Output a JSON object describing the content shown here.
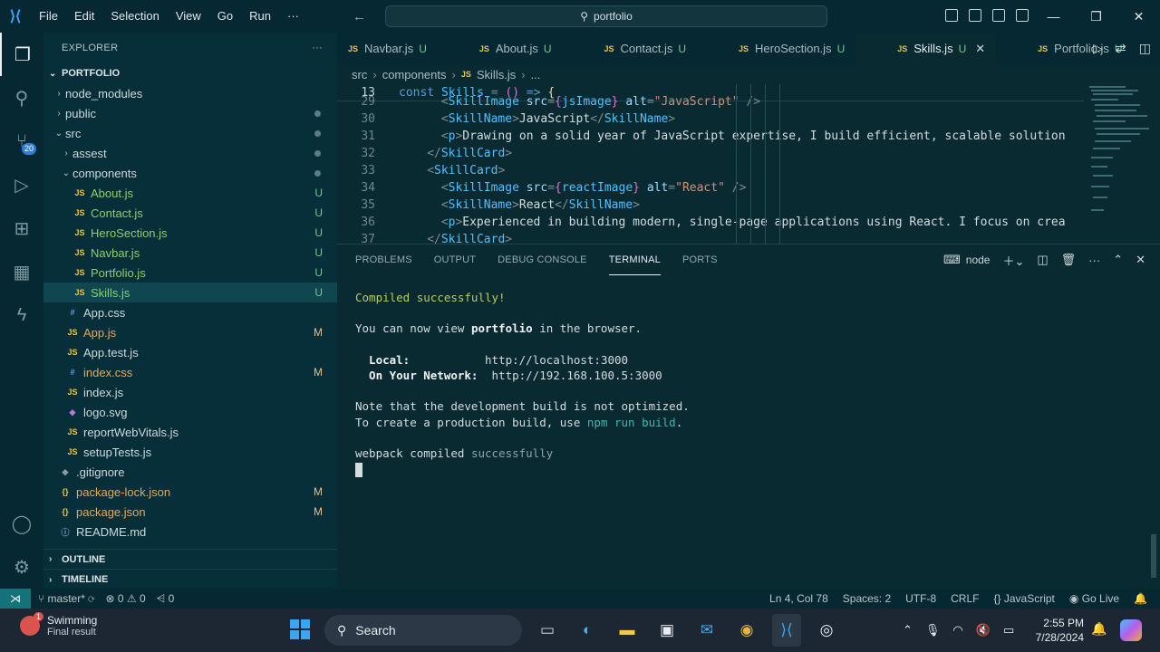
{
  "titlebar": {
    "menu": [
      "File",
      "Edit",
      "Selection",
      "View",
      "Go",
      "Run",
      "···"
    ],
    "search_text": "portfolio",
    "window_controls": [
      "—",
      "❐",
      "✕"
    ]
  },
  "activity": {
    "scm_badge": "20",
    "icons": [
      "explorer-icon",
      "search-icon",
      "source-control-icon",
      "run-debug-icon",
      "extensions-icon",
      "docker-icon",
      "remote-icon"
    ],
    "bottom_icons": [
      "account-icon",
      "settings-icon"
    ]
  },
  "explorer": {
    "title": "EXPLORER",
    "more": "···",
    "root": "PORTFOLIO",
    "items": [
      {
        "label": "node_modules",
        "type": "folder",
        "indent": 1,
        "chev": "›",
        "status": "",
        "dot": false
      },
      {
        "label": "public",
        "type": "folder",
        "indent": 1,
        "chev": "›",
        "status": "",
        "dot": true
      },
      {
        "label": "src",
        "type": "folder",
        "indent": 1,
        "chev": "⌄",
        "status": "",
        "dot": true
      },
      {
        "label": "assest",
        "type": "folder",
        "indent": 2,
        "chev": "›",
        "status": "",
        "dot": true
      },
      {
        "label": "components",
        "type": "folder",
        "indent": 2,
        "chev": "⌄",
        "status": "",
        "dot": true
      },
      {
        "label": "About.js",
        "type": "js",
        "indent": 3,
        "status": "U"
      },
      {
        "label": "Contact.js",
        "type": "js",
        "indent": 3,
        "status": "U"
      },
      {
        "label": "HeroSection.js",
        "type": "js",
        "indent": 3,
        "status": "U"
      },
      {
        "label": "Navbar.js",
        "type": "js",
        "indent": 3,
        "status": "U"
      },
      {
        "label": "Portfolio.js",
        "type": "js",
        "indent": 3,
        "status": "U"
      },
      {
        "label": "Skills.js",
        "type": "js",
        "indent": 3,
        "status": "U",
        "selected": true
      },
      {
        "label": "App.css",
        "type": "css",
        "indent": 2,
        "status": ""
      },
      {
        "label": "App.js",
        "type": "js",
        "indent": 2,
        "status": "M"
      },
      {
        "label": "App.test.js",
        "type": "js",
        "indent": 2,
        "status": ""
      },
      {
        "label": "index.css",
        "type": "css",
        "indent": 2,
        "status": "M"
      },
      {
        "label": "index.js",
        "type": "js",
        "indent": 2,
        "status": ""
      },
      {
        "label": "logo.svg",
        "type": "svg",
        "indent": 2,
        "status": ""
      },
      {
        "label": "reportWebVitals.js",
        "type": "js",
        "indent": 2,
        "status": ""
      },
      {
        "label": "setupTests.js",
        "type": "js",
        "indent": 2,
        "status": ""
      },
      {
        "label": ".gitignore",
        "type": "git",
        "indent": 1,
        "status": ""
      },
      {
        "label": "package-lock.json",
        "type": "json",
        "indent": 1,
        "status": "M"
      },
      {
        "label": "package.json",
        "type": "json",
        "indent": 1,
        "status": "M"
      },
      {
        "label": "README.md",
        "type": "md",
        "indent": 1,
        "status": ""
      }
    ],
    "outline": "OUTLINE",
    "timeline": "TIMELINE"
  },
  "tabs": [
    {
      "label": "Navbar.js",
      "status": "U",
      "active": false
    },
    {
      "label": "About.js",
      "status": "U",
      "active": false
    },
    {
      "label": "Contact.js",
      "status": "U",
      "active": false
    },
    {
      "label": "HeroSection.js",
      "status": "U",
      "active": false
    },
    {
      "label": "Skills.js",
      "status": "U",
      "active": true
    },
    {
      "label": "Portfolio.js",
      "status": "U",
      "active": false
    }
  ],
  "breadcrumb": [
    "src",
    "components",
    "Skills.js",
    "..."
  ],
  "code": {
    "sticky": {
      "ln": "13",
      "text": "const Skills = () => {"
    },
    "lines": [
      {
        "ln": "29",
        "text": "<SkillImage src={jsImage} alt=\"JavaScript\" />"
      },
      {
        "ln": "30",
        "text": "<SkillName>JavaScript</SkillName>"
      },
      {
        "ln": "31",
        "text": "<p>Drawing on a solid year of JavaScript expertise, I build efficient, scalable solution"
      },
      {
        "ln": "32",
        "text": "</SkillCard>"
      },
      {
        "ln": "33",
        "text": "<SkillCard>"
      },
      {
        "ln": "34",
        "text": "<SkillImage src={reactImage} alt=\"React\" />"
      },
      {
        "ln": "35",
        "text": "<SkillName>React</SkillName>"
      },
      {
        "ln": "36",
        "text": "<p>Experienced in building modern, single-page applications using React. I focus on crea"
      },
      {
        "ln": "37",
        "text": "</SkillCard>"
      }
    ]
  },
  "panel": {
    "tabs": [
      "PROBLEMS",
      "OUTPUT",
      "DEBUG CONSOLE",
      "TERMINAL",
      "PORTS"
    ],
    "active_tab": "TERMINAL",
    "shell": "node",
    "terminal": {
      "compiled": "Compiled successfully!",
      "view_pre": "You can now view ",
      "view_app": "portfolio",
      "view_post": " in the browser.",
      "local_label": "  Local:",
      "local_url": "http://localhost:3000",
      "network_label": "  On Your Network:",
      "network_url": "http://192.168.100.5:3000",
      "note": "Note that the development build is not optimized.",
      "prod_pre": "To create a production build, use ",
      "prod_cmd": "npm run build",
      "prod_post": ".",
      "webpack_pre": "webpack compiled ",
      "webpack_post": "successfully"
    }
  },
  "statusbar": {
    "branch": "master*",
    "errors": "0",
    "warnings": "0",
    "ports": "0",
    "position": "Ln 4, Col 78",
    "spaces": "Spaces: 2",
    "encoding": "UTF-8",
    "eol": "CRLF",
    "language": "JavaScript",
    "golive": "Go Live"
  },
  "taskbar": {
    "weather_title": "Swimming",
    "weather_sub": "Final result",
    "search": "Search",
    "time": "2:55 PM",
    "date": "7/28/2024"
  }
}
